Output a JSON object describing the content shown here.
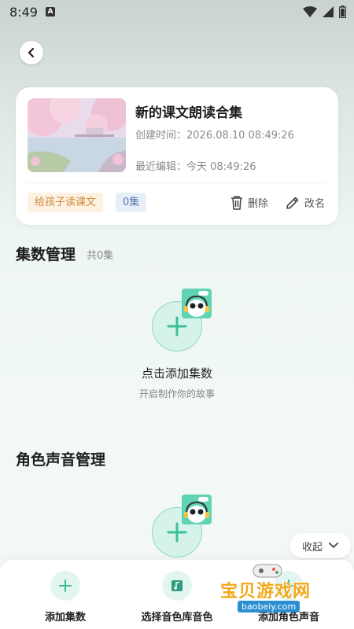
{
  "status_bar": {
    "time": "8:49",
    "notification_letter": "A"
  },
  "collection": {
    "title": "新的课文朗读合集",
    "created": "创建时间：2026.08.10 08:49:26",
    "edited": "最近编辑：今天 08:49:26",
    "tag_category": "给孩子读课文",
    "tag_episodes": "0集",
    "delete_label": "删除",
    "rename_label": "改名"
  },
  "episodes_section": {
    "title": "集数管理",
    "count": "共0集",
    "empty_title": "点击添加集数",
    "empty_subtitle": "开启制作你的故事"
  },
  "voices_section": {
    "title": "角色声音管理"
  },
  "collapse_label": "收起",
  "bottom_bar": {
    "items": [
      {
        "label": "添加集数",
        "icon": "plus-icon"
      },
      {
        "label": "选择音色库音色",
        "icon": "music-library-icon"
      },
      {
        "label": "添加角色声音",
        "icon": "plus-icon"
      }
    ]
  },
  "watermark": {
    "text": "宝贝游戏网",
    "url": "baobeiy.com"
  },
  "colors": {
    "accent": "#5fd4b4",
    "accent_light": "#d6f3ea",
    "tag_orange": "#d08a3b",
    "tag_blue": "#5577aa"
  }
}
